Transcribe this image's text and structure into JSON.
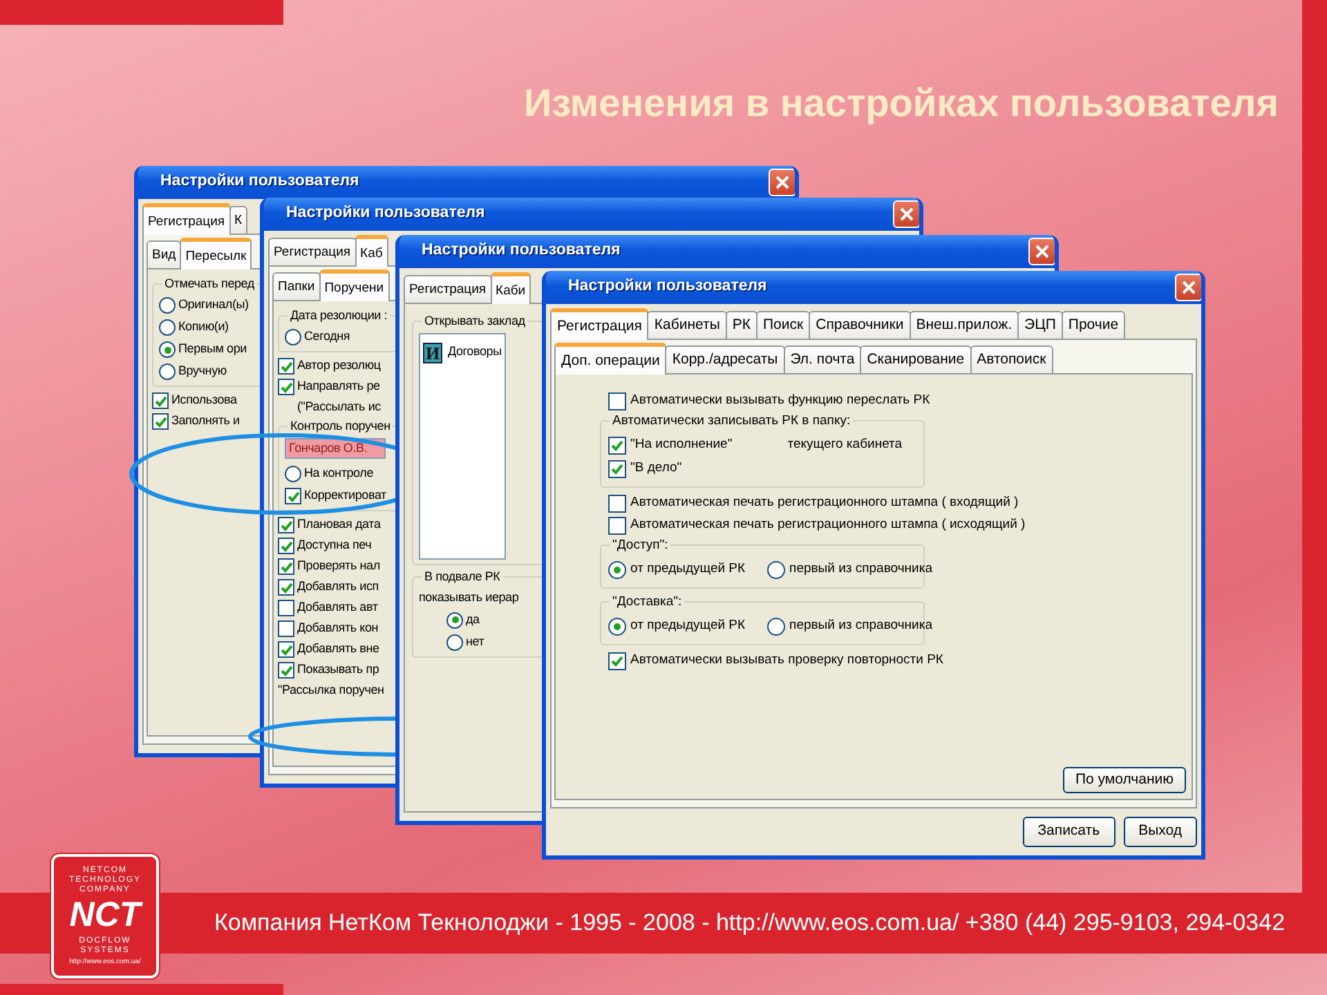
{
  "slide": {
    "title": "Изменения в настройках пользователя",
    "footer": "Компания НетКом Текнолоджи - 1995 - 2008 - http://www.eos.com.ua/ +380 (44) 295-9103, 294-0342",
    "logo": {
      "lines_top": [
        "NETCOM",
        "TECHNOLOGY",
        "COMPANY"
      ],
      "mark": "NCT",
      "lines_bottom": [
        "DOCFLOW",
        "SYSTEMS"
      ],
      "url": "http://www.eos.com.ua/"
    }
  },
  "windows": [
    {
      "title": "Настройки пользователя",
      "tabs": [
        {
          "label": "Регистрация",
          "selected": true
        },
        {
          "label": "К",
          "selected": false
        }
      ],
      "subtabs": [
        {
          "label": "Вид",
          "selected": false
        },
        {
          "label": "Пересылк",
          "selected": true
        }
      ],
      "content": [
        {
          "kind": "group",
          "label": "Отмечать перед",
          "items": [
            {
              "kind": "radio",
              "label": "Оригинал(ы)",
              "selected": false
            },
            {
              "kind": "radio",
              "label": "Копию(и)",
              "selected": false
            },
            {
              "kind": "radio",
              "label": "Первым ори",
              "selected": true
            },
            {
              "kind": "radio",
              "label": "Вручную",
              "selected": false
            }
          ]
        },
        {
          "kind": "checkbox",
          "label": "Использова",
          "checked": true
        },
        {
          "kind": "checkbox",
          "label": "Заполнять и",
          "checked": true
        }
      ]
    },
    {
      "title": "Настройки пользователя",
      "tabs": [
        {
          "label": "Регистрация",
          "selected": false
        },
        {
          "label": "Каб",
          "selected": true
        }
      ],
      "subtabs": [
        {
          "label": "Папки",
          "selected": false
        },
        {
          "label": "Поручени",
          "selected": true
        }
      ],
      "content": [
        {
          "kind": "group",
          "label": "Дата резолюции :",
          "items": [
            {
              "kind": "radio",
              "label": "Сегодня",
              "selected": false
            }
          ]
        },
        {
          "kind": "checkbox",
          "label": "Автор резолюц",
          "checked": true
        },
        {
          "kind": "checkbox",
          "label": "Направлять ре",
          "checked": true
        },
        {
          "kind": "note",
          "label": "(\"Рассылать ис"
        },
        {
          "kind": "group",
          "label": "Контроль поручен",
          "items": [
            {
              "kind": "field",
              "value": "Гончаров О.В."
            },
            {
              "kind": "radio",
              "label": "На контроле",
              "selected": false
            },
            {
              "kind": "checkbox",
              "label": "Корректироват",
              "checked": true
            }
          ]
        },
        {
          "kind": "checkbox",
          "label": "Плановая дата",
          "checked": true
        },
        {
          "kind": "checkbox",
          "label": "Доступна печ",
          "checked": true
        },
        {
          "kind": "checkbox",
          "label": "Проверять нал",
          "checked": true
        },
        {
          "kind": "checkbox",
          "label": "Добавлять исп",
          "checked": true
        },
        {
          "kind": "checkbox",
          "label": "Добавлять авт",
          "checked": false
        },
        {
          "kind": "checkbox",
          "label": "Добавлять кон",
          "checked": false
        },
        {
          "kind": "checkbox",
          "label": "Добавлять вне",
          "checked": true
        },
        {
          "kind": "checkbox",
          "label": "Показывать пр",
          "checked": true
        },
        {
          "kind": "text",
          "label": "\"Рассылка поручен"
        }
      ]
    },
    {
      "title": "Настройки пользователя",
      "tabs": [
        {
          "label": "Регистрация",
          "selected": false
        },
        {
          "label": "Каби",
          "selected": true
        }
      ],
      "content": [
        {
          "kind": "group",
          "label": "Открывать заклад",
          "items": [
            {
              "kind": "listbox",
              "items": [
                {
                  "icon_letter": "И",
                  "label": "Договоры"
                }
              ]
            }
          ]
        },
        {
          "kind": "group",
          "label": "В подвале РК",
          "items": [
            {
              "kind": "text",
              "label": "показывать иерар"
            },
            {
              "kind": "radio",
              "label": "да",
              "selected": true
            },
            {
              "kind": "radio",
              "label": "нет",
              "selected": false
            }
          ]
        }
      ]
    },
    {
      "title": "Настройки пользователя",
      "tabs": [
        {
          "label": "Регистрация",
          "selected": true
        },
        {
          "label": "Кабинеты",
          "selected": false
        },
        {
          "label": "РК",
          "selected": false
        },
        {
          "label": "Поиск",
          "selected": false
        },
        {
          "label": "Справочники",
          "selected": false
        },
        {
          "label": "Внеш.прилож.",
          "selected": false
        },
        {
          "label": "ЭЦП",
          "selected": false
        },
        {
          "label": "Прочие",
          "selected": false
        }
      ],
      "subtabs": [
        {
          "label": "Доп. операции",
          "selected": true
        },
        {
          "label": "Корр./адресаты",
          "selected": false
        },
        {
          "label": "Эл. почта",
          "selected": false
        },
        {
          "label": "Сканирование",
          "selected": false
        },
        {
          "label": "Автопоиск",
          "selected": false
        }
      ],
      "content": [
        {
          "kind": "checkbox",
          "label": "Автоматически вызывать функцию переслать РК",
          "checked": false
        },
        {
          "kind": "group",
          "label": "Автоматически записывать РК в папку:",
          "items": [
            {
              "kind": "checkbox",
              "label": "\"На исполнение\"",
              "checked": true
            },
            {
              "kind": "checkbox",
              "label": "\"В дело\"",
              "checked": true
            },
            {
              "kind": "aside",
              "label": "текущего кабинета"
            }
          ]
        },
        {
          "kind": "checkbox",
          "label": "Автоматическая печать регистрационного штампа ( входящий )",
          "checked": false
        },
        {
          "kind": "checkbox",
          "label": "Автоматическая печать регистрационного штампа ( исходящий )",
          "checked": false
        },
        {
          "kind": "group",
          "label": "\"Доступ\":",
          "items": [
            {
              "kind": "radio_row",
              "options": [
                {
                  "label": "от предыдущей РК",
                  "selected": true
                },
                {
                  "label": "первый из справочника",
                  "selected": false
                }
              ]
            }
          ]
        },
        {
          "kind": "group",
          "label": "\"Доставка\":",
          "items": [
            {
              "kind": "radio_row",
              "options": [
                {
                  "label": "от предыдущей РК",
                  "selected": true
                },
                {
                  "label": "первый из справочника",
                  "selected": false
                }
              ]
            }
          ]
        },
        {
          "kind": "checkbox",
          "label": "Автоматически вызывать проверку повторности РК",
          "checked": true
        }
      ],
      "panel_button": "По умолчанию",
      "buttons": [
        "Записать",
        "Выход"
      ]
    }
  ]
}
